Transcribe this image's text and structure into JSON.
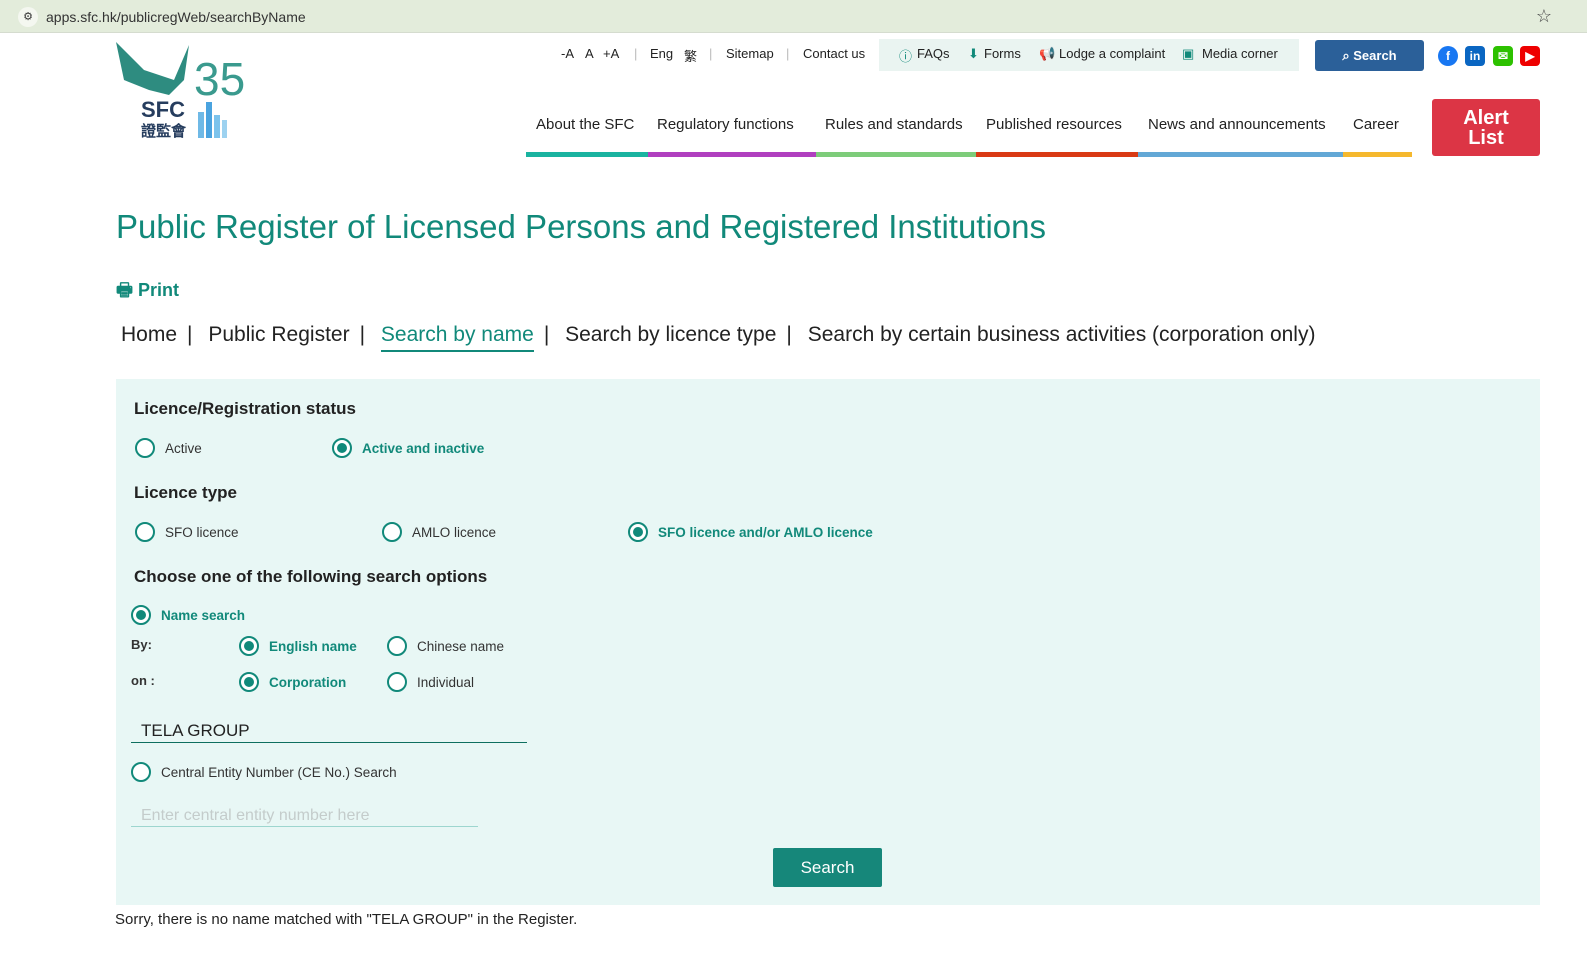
{
  "browser": {
    "url": "apps.sfc.hk/publicregWeb/searchByName"
  },
  "logo": {
    "text": "SFC",
    "chinese": "證監會",
    "anniversary": "35"
  },
  "utility": {
    "font_minus": "-A",
    "font_normal": "A",
    "font_plus": "+A",
    "lang_en": "Eng",
    "lang_zh": "繁",
    "sitemap": "Sitemap",
    "contact": "Contact us"
  },
  "toolbox": {
    "faqs": "FAQs",
    "forms": "Forms",
    "complaint": "Lodge a complaint",
    "media": "Media corner"
  },
  "search_button": "Search",
  "social": [
    "facebook",
    "linkedin",
    "wechat",
    "youtube"
  ],
  "nav": [
    {
      "label": "About the SFC",
      "color": "#1ab3a0"
    },
    {
      "label": "Regulatory functions",
      "color": "#b03fbf"
    },
    {
      "label": "Rules and standards",
      "color": "#7dcc7a"
    },
    {
      "label": "Published resources",
      "color": "#d93a14"
    },
    {
      "label": "News and announcements",
      "color": "#63a8d6"
    },
    {
      "label": "Career",
      "color": "#f5b82e"
    }
  ],
  "alert": "Alert List",
  "page": {
    "title": "Public Register of Licensed Persons and Registered Institutions",
    "print": "Print"
  },
  "breadcrumb": {
    "home": "Home",
    "register": "Public Register",
    "by_name": "Search by name",
    "by_licence": "Search by licence type",
    "by_activity": "Search by certain business activities (corporation only)"
  },
  "form": {
    "status_heading": "Licence/Registration status",
    "status": {
      "active": "Active",
      "both": "Active and inactive",
      "selected": "both"
    },
    "type_heading": "Licence type",
    "type": {
      "sfo": "SFO licence",
      "amlo": "AMLO licence",
      "both": "SFO licence and/or AMLO licence",
      "selected": "both"
    },
    "options_heading": "Choose one of the following search options",
    "name_search": "Name search",
    "by_label": "By:",
    "english": "English name",
    "chinese": "Chinese name",
    "on_label": "on :",
    "corporation": "Corporation",
    "individual": "Individual",
    "name_value": "TELA GROUP",
    "ce_search": "Central Entity Number (CE No.) Search",
    "ce_placeholder": "Enter central entity number here",
    "submit": "Search"
  },
  "message": "Sorry, there is no name matched with \"TELA GROUP\" in the Register.",
  "colors": {
    "accent": "#11897a",
    "panel": "#e8f7f5",
    "alert": "#dc3545",
    "search": "#2b6099"
  }
}
